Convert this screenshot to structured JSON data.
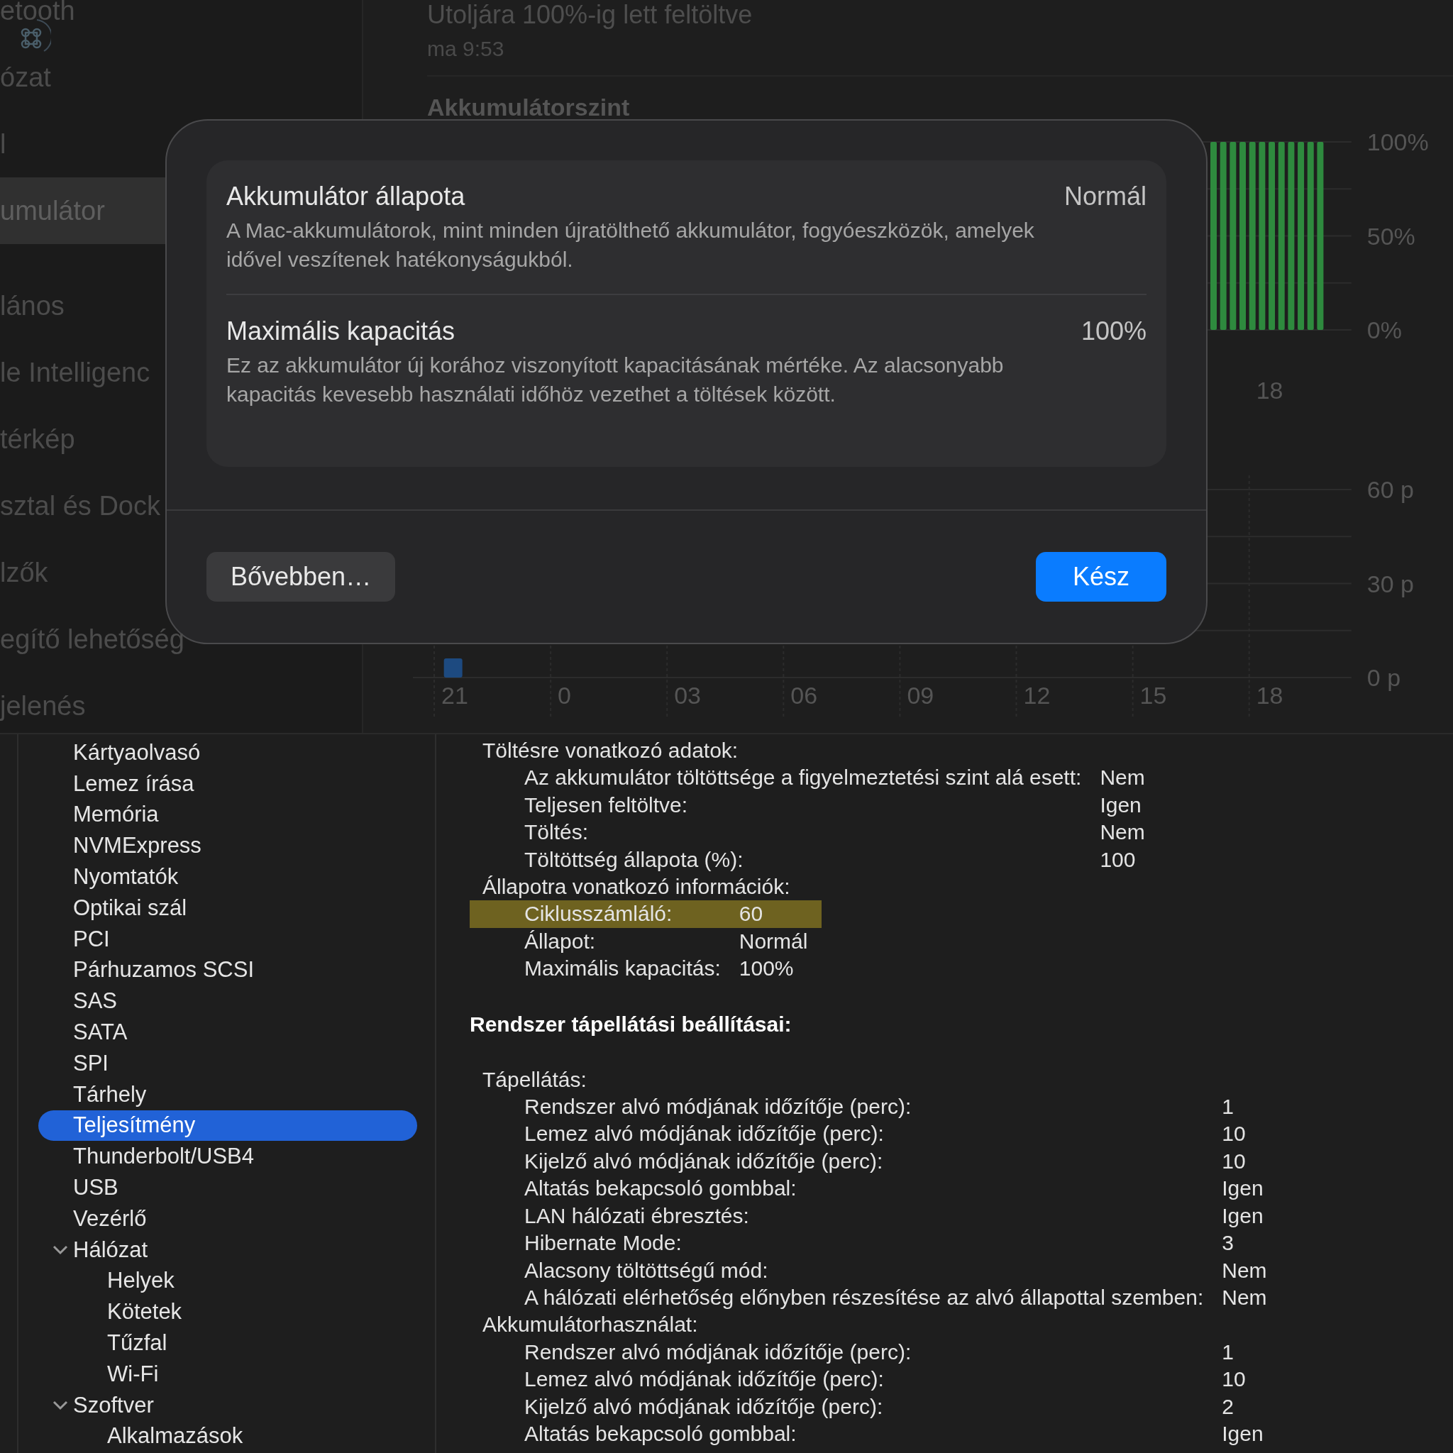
{
  "settings": {
    "sidebar": {
      "groups": [
        {
          "items": [
            {
              "label": "etooth",
              "selected": false
            },
            {
              "label": "ózat",
              "selected": false
            },
            {
              "label": "l",
              "selected": false
            },
            {
              "label": "umulátor",
              "selected": true
            }
          ]
        },
        {
          "items": [
            {
              "label": "lános",
              "selected": false
            },
            {
              "label": "le Intelligenc",
              "selected": false
            },
            {
              "label": "térkép",
              "selected": false
            },
            {
              "label": "sztal és Dock",
              "selected": false
            },
            {
              "label": "lzők",
              "selected": false
            },
            {
              "label": "egítő lehetőség",
              "selected": false
            },
            {
              "label": "jelenés",
              "selected": false
            }
          ]
        }
      ]
    },
    "last_charged": {
      "title": "Utoljára 100%-ig lett feltöltve",
      "time": "ma 9:53"
    },
    "level_section": {
      "title": "Akkumulátorszint",
      "y_labels": [
        "100%",
        "50%",
        "0%"
      ],
      "x_labels": [
        "18"
      ]
    },
    "usage_section": {
      "y_labels": [
        "60 p",
        "30 p",
        "0 p"
      ],
      "x_labels": [
        "21",
        "0",
        "03",
        "06",
        "09",
        "12",
        "15",
        "18"
      ]
    },
    "dialog": {
      "rows": [
        {
          "title": "Akkumulátor állapota",
          "value": "Normál",
          "description": "A Mac-akkumulátorok, mint minden újratölthető akkumulátor, fogyóeszközök, amelyek idővel veszítenek hatékonyságukból."
        },
        {
          "title": "Maximális kapacitás",
          "value": "100%",
          "description": "Ez az akkumulátor új korához viszonyított kapacitásának mértéke. Az alacsonyabb kapacitás kevesebb használati időhöz vezethet a töltések között."
        }
      ],
      "buttons": [
        {
          "label": "Bővebben…",
          "kind": "secondary"
        },
        {
          "label": "Kész",
          "kind": "primary"
        }
      ]
    }
  },
  "sysinfo": {
    "tree": [
      {
        "children": [
          {
            "label": "Kártyaolvasó",
            "selected": false
          },
          {
            "label": "Lemez írása",
            "selected": false
          },
          {
            "label": "Memória",
            "selected": false
          },
          {
            "label": "NVMExpress",
            "selected": false
          },
          {
            "label": "Nyomtatók",
            "selected": false
          },
          {
            "label": "Optikai szál",
            "selected": false
          },
          {
            "label": "PCI",
            "selected": false
          },
          {
            "label": "Párhuzamos SCSI",
            "selected": false
          },
          {
            "label": "SAS",
            "selected": false
          },
          {
            "label": "SATA",
            "selected": false
          },
          {
            "label": "SPI",
            "selected": false
          },
          {
            "label": "Tárhely",
            "selected": false
          },
          {
            "label": "Teljesítmény",
            "selected": true
          },
          {
            "label": "Thunderbolt/USB4",
            "selected": false
          },
          {
            "label": "USB",
            "selected": false
          },
          {
            "label": "Vezérlő",
            "selected": false
          }
        ]
      },
      {
        "label": "Hálózat",
        "selected": false,
        "expanded": true,
        "children": [
          {
            "label": "Helyek",
            "selected": false
          },
          {
            "label": "Kötetek",
            "selected": false
          },
          {
            "label": "Tűzfal",
            "selected": false
          },
          {
            "label": "Wi-Fi",
            "selected": false
          }
        ]
      },
      {
        "label": "Szoftver",
        "selected": false,
        "expanded": true,
        "children": [
          {
            "label": "Alkalmazások",
            "selected": false
          }
        ]
      }
    ],
    "blocks": [
      {
        "kind": "table",
        "groups": [
          {
            "title": "Töltésre vonatkozó adatok:",
            "rows": [
              {
                "label": "Az akkumulátor töltöttsége a figyelmeztetési szint alá esett:",
                "value": "Nem",
                "highlighted": false
              },
              {
                "label": "Teljesen feltöltve:",
                "value": "Igen",
                "highlighted": false
              },
              {
                "label": "Töltés:",
                "value": "Nem",
                "highlighted": false
              },
              {
                "label": "Töltöttség állapota (%):",
                "value": "100",
                "highlighted": false
              }
            ]
          }
        ]
      },
      {
        "kind": "table",
        "groups": [
          {
            "title": "Állapotra vonatkozó információk:",
            "rows": [
              {
                "label": "Ciklusszámláló:",
                "value": "60",
                "highlighted": true
              },
              {
                "label": "Állapot:",
                "value": "Normál",
                "highlighted": false
              },
              {
                "label": "Maximális kapacitás:",
                "value": "100%",
                "highlighted": false
              }
            ]
          }
        ]
      },
      {
        "kind": "heading",
        "text": "Rendszer tápellátási beállításai:"
      },
      {
        "kind": "table",
        "groups": [
          {
            "title": "Tápellátás:",
            "rows": [
              {
                "label": "Rendszer alvó módjának időzítője (perc):",
                "value": "1",
                "highlighted": false
              },
              {
                "label": "Lemez alvó módjának időzítője (perc):",
                "value": "10",
                "highlighted": false
              },
              {
                "label": "Kijelző alvó módjának időzítője (perc):",
                "value": "10",
                "highlighted": false
              },
              {
                "label": "Altatás bekapcsoló gombbal:",
                "value": "Igen",
                "highlighted": false
              },
              {
                "label": "LAN hálózati ébresztés:",
                "value": "Igen",
                "highlighted": false
              },
              {
                "label": "Hibernate Mode:",
                "value": "3",
                "highlighted": false
              },
              {
                "label": "Alacsony töltöttségű mód:",
                "value": "Nem",
                "highlighted": false
              },
              {
                "label": "A hálózati elérhetőség előnyben részesítése az alvó állapottal szemben:",
                "value": "Nem",
                "highlighted": false
              }
            ]
          },
          {
            "title": "Akkumulátorhasználat:",
            "rows": [
              {
                "label": "Rendszer alvó módjának időzítője (perc):",
                "value": "1",
                "highlighted": false
              },
              {
                "label": "Lemez alvó módjának időzítője (perc):",
                "value": "10",
                "highlighted": false
              },
              {
                "label": "Kijelző alvó módjának időzítője (perc):",
                "value": "2",
                "highlighted": false
              },
              {
                "label": "Altatás bekapcsoló gombbal:",
                "value": "Igen",
                "highlighted": false
              }
            ]
          }
        ]
      }
    ]
  }
}
